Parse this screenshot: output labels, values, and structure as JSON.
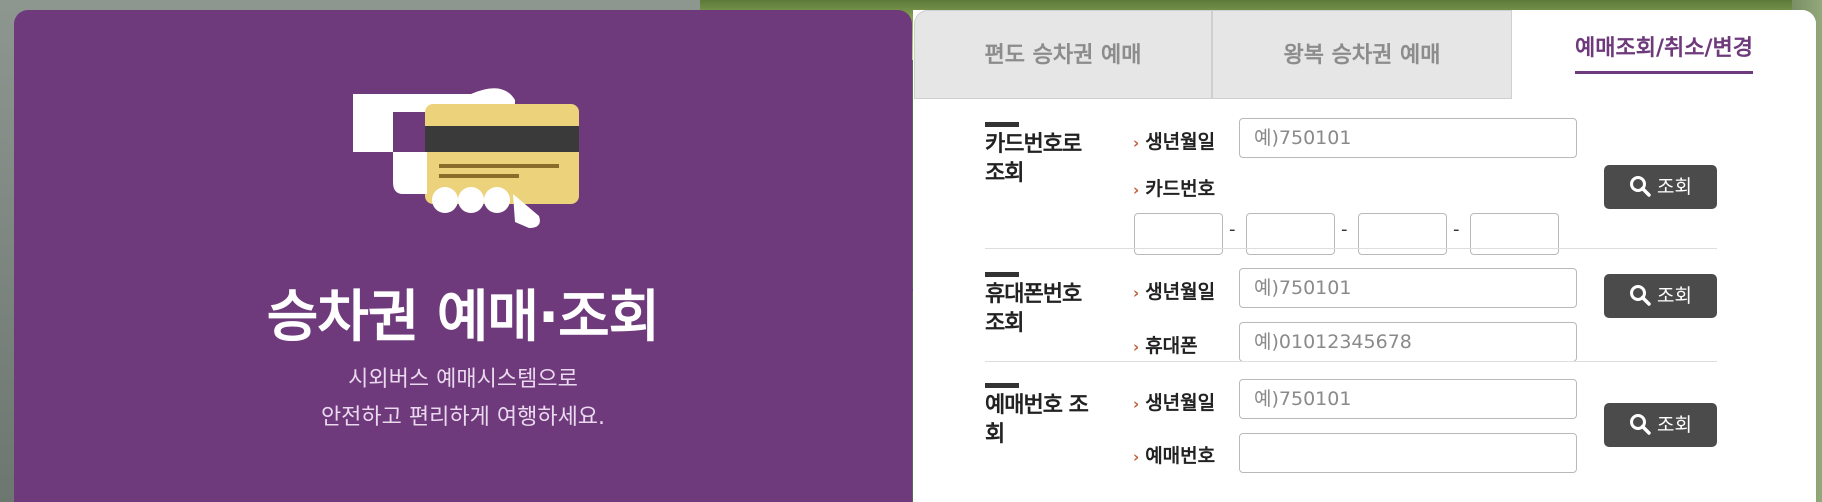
{
  "promo": {
    "title": "승차권 예매·조회",
    "subtitle_line1": "시외버스 예매시스템으로",
    "subtitle_line2": "안전하고 편리하게 여행하세요."
  },
  "tabs": [
    {
      "label": "편도 승차권 예매",
      "active": false
    },
    {
      "label": "왕복 승차권 예매",
      "active": false
    },
    {
      "label": "예매조회/취소/변경",
      "active": true
    }
  ],
  "sections": {
    "card": {
      "title": "카드번호로 조회",
      "birth_label": "생년월일",
      "birth_placeholder": "예)750101",
      "card_label": "카드번호",
      "card_separator": "-",
      "button_label": "조회"
    },
    "phone": {
      "title": "휴대폰번호 조회",
      "birth_label": "생년월일",
      "birth_placeholder": "예)750101",
      "phone_label": "휴대폰",
      "phone_placeholder": "예)01012345678",
      "button_label": "조회"
    },
    "reservation": {
      "title": "예매번호 조회",
      "birth_label": "생년월일",
      "birth_placeholder": "예)750101",
      "number_label": "예매번호",
      "number_placeholder": "",
      "button_label": "조회"
    }
  },
  "icons": {
    "illustration": "hand-holding-card-icon",
    "search": "search-icon",
    "chevron": "chevron-right-icon"
  },
  "colors": {
    "brand_purple": "#6e3a7b",
    "button_dark": "#4b4b4b",
    "chevron_orange": "#c0603e",
    "card_yellow": "#ecd27a"
  }
}
